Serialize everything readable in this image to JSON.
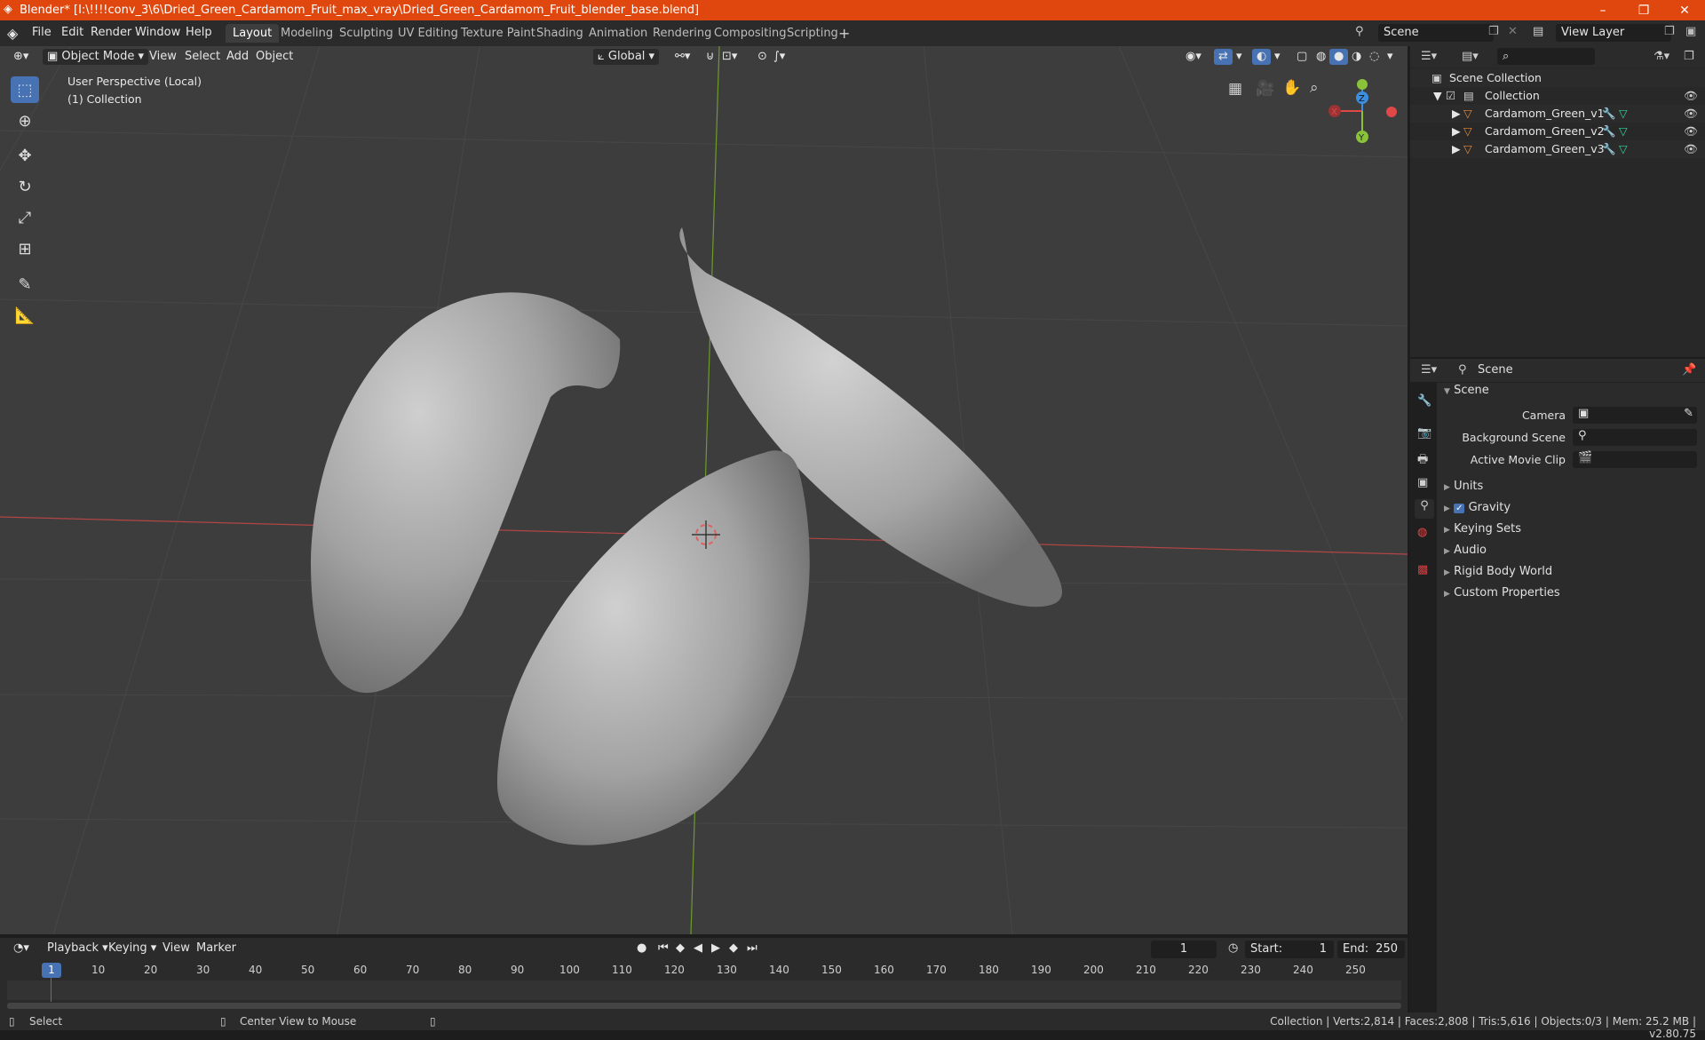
{
  "window": {
    "title": "Blender* [I:\\!!!!conv_3\\6\\Dried_Green_Cardamom_Fruit_max_vray\\Dried_Green_Cardamom_Fruit_blender_base.blend]"
  },
  "menu": [
    "File",
    "Edit",
    "Render",
    "Window",
    "Help"
  ],
  "workspaces": [
    "Layout",
    "Modeling",
    "Sculpting",
    "UV Editing",
    "Texture Paint",
    "Shading",
    "Animation",
    "Rendering",
    "Compositing",
    "Scripting"
  ],
  "scene_field": "Scene",
  "view_layer_field": "View Layer",
  "viewport_header": {
    "mode": "Object Mode",
    "view": "View",
    "select": "Select",
    "add": "Add",
    "object": "Object",
    "orientation": "Global"
  },
  "viewport_overlay": {
    "perspective": "User Perspective (Local)",
    "collection": "(1) Collection"
  },
  "gizmo": {
    "x": "X",
    "y": "Y",
    "z": "Z"
  },
  "outliner": {
    "root": "Scene Collection",
    "collection": "Collection",
    "objects": [
      "Cardamom_Green_v1",
      "Cardamom_Green_v2",
      "Cardamom_Green_v3"
    ]
  },
  "properties": {
    "header": "Scene",
    "panel": "Scene",
    "camera_label": "Camera",
    "background_label": "Background Scene",
    "movieclip_label": "Active Movie Clip",
    "sections": [
      "Units",
      "Gravity",
      "Keying Sets",
      "Audio",
      "Rigid Body World",
      "Custom Properties"
    ]
  },
  "timeline": {
    "playback": "Playback",
    "keying": "Keying",
    "view": "View",
    "marker": "Marker",
    "current_frame": "1",
    "start_label": "Start:",
    "start": "1",
    "end_label": "End:",
    "end": "250",
    "ticks": [
      "1",
      "10",
      "20",
      "30",
      "40",
      "50",
      "60",
      "70",
      "80",
      "90",
      "100",
      "110",
      "120",
      "130",
      "140",
      "150",
      "160",
      "170",
      "180",
      "190",
      "200",
      "210",
      "220",
      "230",
      "240",
      "250"
    ]
  },
  "status": {
    "select": "Select",
    "center": "Center View to Mouse",
    "info": "Collection | Verts:2,814 | Faces:2,808 | Tris:5,616 | Objects:0/3 | Mem: 25.2 MB | v2.80.75"
  },
  "colors": {
    "titlebar": "#e0470e",
    "accent": "#4772b3",
    "x_axis": "#e04848",
    "y_axis": "#8ac33a",
    "z_axis": "#3c8fe0"
  }
}
